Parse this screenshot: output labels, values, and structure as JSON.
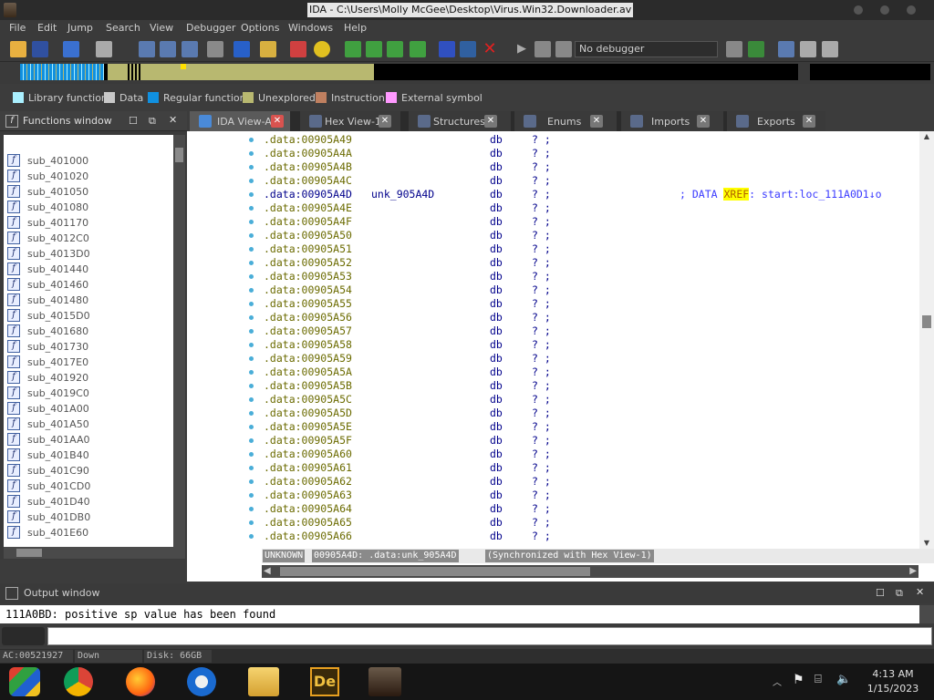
{
  "window": {
    "title": "IDA - C:\\Users\\Molly McGee\\Desktop\\Virus.Win32.Downloader.av"
  },
  "menu": [
    "File",
    "Edit",
    "Jump",
    "Search",
    "View",
    "Debugger",
    "Options",
    "Windows",
    "Help"
  ],
  "toolbar": {
    "debugger_select": "No debugger"
  },
  "legend": [
    {
      "label": "Library function",
      "color": "#aaf0ff"
    },
    {
      "label": "Data",
      "color": "#c8c8c8"
    },
    {
      "label": "Regular function",
      "color": "#1090e0"
    },
    {
      "label": "Unexplored",
      "color": "#b8b870"
    },
    {
      "label": "Instruction",
      "color": "#c08060"
    },
    {
      "label": "External symbol",
      "color": "#ff99ff"
    }
  ],
  "functions_panel": {
    "title": "Functions window",
    "items": [
      "sub_401000",
      "sub_401020",
      "sub_401050",
      "sub_401080",
      "sub_401170",
      "sub_4012C0",
      "sub_4013D0",
      "sub_401440",
      "sub_401460",
      "sub_401480",
      "sub_4015D0",
      "sub_401680",
      "sub_401730",
      "sub_4017E0",
      "sub_401920",
      "sub_4019C0",
      "sub_401A00",
      "sub_401A50",
      "sub_401AA0",
      "sub_401B40",
      "sub_401C90",
      "sub_401CD0",
      "sub_401D40",
      "sub_401DB0",
      "sub_401E60"
    ]
  },
  "tabs": [
    {
      "label": "IDA View-A",
      "active": true
    },
    {
      "label": "Hex View-1",
      "active": false
    },
    {
      "label": "Structures",
      "active": false
    },
    {
      "label": "Enums",
      "active": false
    },
    {
      "label": "Imports",
      "active": false
    },
    {
      "label": "Exports",
      "active": false
    }
  ],
  "ida_view": {
    "lines": [
      {
        "addr": ".data:00905A49",
        "label": "",
        "op": "db",
        "val": "? ;",
        "cmt": ""
      },
      {
        "addr": ".data:00905A4A",
        "label": "",
        "op": "db",
        "val": "? ;",
        "cmt": ""
      },
      {
        "addr": ".data:00905A4B",
        "label": "",
        "op": "db",
        "val": "? ;",
        "cmt": ""
      },
      {
        "addr": ".data:00905A4C",
        "label": "",
        "op": "db",
        "val": "? ;",
        "cmt": ""
      },
      {
        "addr": ".data:00905A4D",
        "label": "unk_905A4D",
        "op": "db",
        "val": "? ;",
        "cmt_pre": "; DATA ",
        "cmt_hl": "XREF",
        "cmt_post": ": start:loc_111A0D1↓o",
        "current": true
      },
      {
        "addr": ".data:00905A4E",
        "label": "",
        "op": "db",
        "val": "? ;",
        "cmt": ""
      },
      {
        "addr": ".data:00905A4F",
        "label": "",
        "op": "db",
        "val": "? ;",
        "cmt": ""
      },
      {
        "addr": ".data:00905A50",
        "label": "",
        "op": "db",
        "val": "? ;",
        "cmt": ""
      },
      {
        "addr": ".data:00905A51",
        "label": "",
        "op": "db",
        "val": "? ;",
        "cmt": ""
      },
      {
        "addr": ".data:00905A52",
        "label": "",
        "op": "db",
        "val": "? ;",
        "cmt": ""
      },
      {
        "addr": ".data:00905A53",
        "label": "",
        "op": "db",
        "val": "? ;",
        "cmt": ""
      },
      {
        "addr": ".data:00905A54",
        "label": "",
        "op": "db",
        "val": "? ;",
        "cmt": ""
      },
      {
        "addr": ".data:00905A55",
        "label": "",
        "op": "db",
        "val": "? ;",
        "cmt": ""
      },
      {
        "addr": ".data:00905A56",
        "label": "",
        "op": "db",
        "val": "? ;",
        "cmt": ""
      },
      {
        "addr": ".data:00905A57",
        "label": "",
        "op": "db",
        "val": "? ;",
        "cmt": ""
      },
      {
        "addr": ".data:00905A58",
        "label": "",
        "op": "db",
        "val": "? ;",
        "cmt": ""
      },
      {
        "addr": ".data:00905A59",
        "label": "",
        "op": "db",
        "val": "? ;",
        "cmt": ""
      },
      {
        "addr": ".data:00905A5A",
        "label": "",
        "op": "db",
        "val": "? ;",
        "cmt": ""
      },
      {
        "addr": ".data:00905A5B",
        "label": "",
        "op": "db",
        "val": "? ;",
        "cmt": ""
      },
      {
        "addr": ".data:00905A5C",
        "label": "",
        "op": "db",
        "val": "? ;",
        "cmt": ""
      },
      {
        "addr": ".data:00905A5D",
        "label": "",
        "op": "db",
        "val": "? ;",
        "cmt": ""
      },
      {
        "addr": ".data:00905A5E",
        "label": "",
        "op": "db",
        "val": "? ;",
        "cmt": ""
      },
      {
        "addr": ".data:00905A5F",
        "label": "",
        "op": "db",
        "val": "? ;",
        "cmt": ""
      },
      {
        "addr": ".data:00905A60",
        "label": "",
        "op": "db",
        "val": "? ;",
        "cmt": ""
      },
      {
        "addr": ".data:00905A61",
        "label": "",
        "op": "db",
        "val": "? ;",
        "cmt": ""
      },
      {
        "addr": ".data:00905A62",
        "label": "",
        "op": "db",
        "val": "? ;",
        "cmt": ""
      },
      {
        "addr": ".data:00905A63",
        "label": "",
        "op": "db",
        "val": "? ;",
        "cmt": ""
      },
      {
        "addr": ".data:00905A64",
        "label": "",
        "op": "db",
        "val": "? ;",
        "cmt": ""
      },
      {
        "addr": ".data:00905A65",
        "label": "",
        "op": "db",
        "val": "? ;",
        "cmt": ""
      },
      {
        "addr": ".data:00905A66",
        "label": "",
        "op": "db",
        "val": "? ;",
        "cmt": ""
      }
    ],
    "status": [
      "UNKNOWN",
      "00905A4D: .data:unk_905A4D",
      "(Synchronized with Hex View-1)"
    ]
  },
  "output": {
    "title": "Output window",
    "text": "111A0BD: positive sp value has been found"
  },
  "statusbar": {
    "ac": "AC:00521927",
    "dir": "Down",
    "disk": "Disk: 66GB"
  },
  "taskbar": {
    "apps": [
      "Start",
      "Google Chrome",
      "Firefox",
      "Opera",
      "File Explorer",
      "Adobe Dreamweaver",
      "IDA"
    ],
    "time": "4:13 AM",
    "date": "1/15/2023"
  }
}
